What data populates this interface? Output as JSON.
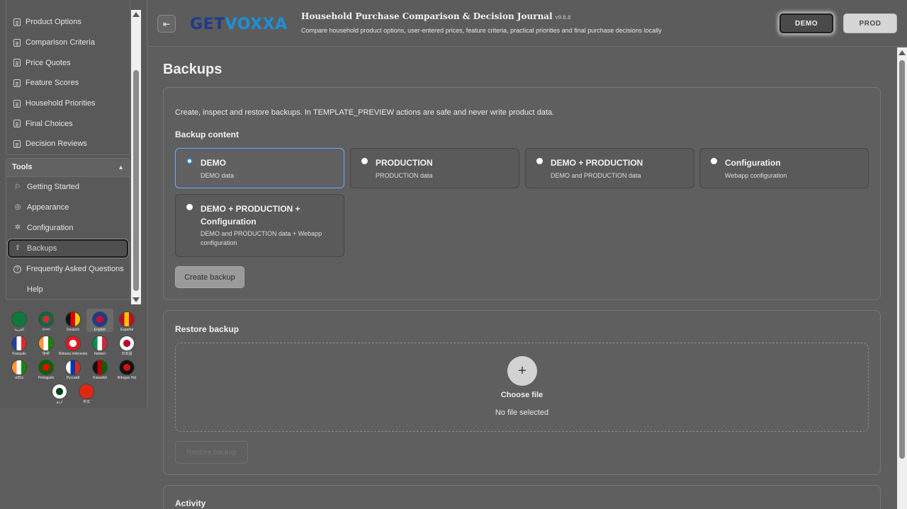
{
  "sidebar": {
    "items": [
      {
        "label": "Product Options"
      },
      {
        "label": "Comparison Criteria"
      },
      {
        "label": "Price Quotes"
      },
      {
        "label": "Feature Scores"
      },
      {
        "label": "Household Priorities"
      },
      {
        "label": "Final Choices"
      },
      {
        "label": "Decision Reviews"
      }
    ],
    "tools_title": "Tools",
    "tools": [
      {
        "label": "Getting Started",
        "icon": "flag-icon"
      },
      {
        "label": "Appearance",
        "icon": "palette-icon"
      },
      {
        "label": "Configuration",
        "icon": "gear-icon"
      },
      {
        "label": "Backups",
        "icon": "upload-icon",
        "active": true
      },
      {
        "label": "Frequently Asked Questions",
        "icon": "question-icon"
      },
      {
        "label": "Help",
        "icon": "none"
      }
    ]
  },
  "languages": [
    {
      "label": "العربية",
      "colors": [
        "#0b7a3b",
        "#0b7a3b"
      ]
    },
    {
      "label": "বাংলা",
      "colors": [
        "#0a6a3f",
        "#d42a3c"
      ]
    },
    {
      "label": "Deutsch",
      "colors": [
        "#111111",
        "#dd0000",
        "#ffcc00"
      ]
    },
    {
      "label": "English",
      "colors": [
        "#1f3b8c",
        "#c8102e"
      ],
      "selected": true
    },
    {
      "label": "Español",
      "colors": [
        "#c60b1e",
        "#ffc400",
        "#c60b1e"
      ]
    },
    {
      "label": "Français",
      "colors": [
        "#1f3f99",
        "#ffffff",
        "#e1262d"
      ]
    },
    {
      "label": "हिन्दी",
      "colors": [
        "#ff9933",
        "#ffffff",
        "#138808"
      ]
    },
    {
      "label": "Bahasa Indonesia",
      "colors": [
        "#e11a22",
        "#ffffff"
      ]
    },
    {
      "label": "Italiano",
      "colors": [
        "#009246",
        "#ffffff",
        "#ce2b37"
      ]
    },
    {
      "label": "日本語",
      "colors": [
        "#ffffff",
        "#bc002d"
      ]
    },
    {
      "label": "ଓଡ଼ିଆ",
      "colors": [
        "#ff9933",
        "#ffffff",
        "#138808"
      ]
    },
    {
      "label": "Português",
      "colors": [
        "#006600",
        "#ff0000"
      ]
    },
    {
      "label": "Русский",
      "colors": [
        "#ffffff",
        "#0039a6",
        "#d52b1e"
      ]
    },
    {
      "label": "Kiswahili",
      "colors": [
        "#111111",
        "#bb0000",
        "#006600"
      ]
    },
    {
      "label": "tlhIngan Hol",
      "colors": [
        "#111111",
        "#cc1111"
      ]
    },
    {
      "label": "اردو",
      "colors": [
        "#ffffff",
        "#01411c"
      ]
    },
    {
      "label": "中文",
      "colors": [
        "#de2910",
        "#de2910"
      ]
    }
  ],
  "header": {
    "logo_a": "GET",
    "logo_b": "V",
    "logo_c": "OXXA",
    "title": "Household Purchase Comparison & Decision Journal",
    "version": "v9.8.8",
    "subtitle": "Compare household product options, user-entered prices, feature criteria, practical priorities and final purchase decisions locally",
    "env_demo": "DEMO",
    "env_prod": "PROD"
  },
  "page": {
    "title": "Backups",
    "intro": "Create, inspect and restore backups. In TEMPLATE_PREVIEW actions are safe and never write product data.",
    "backup_content_label": "Backup content",
    "options": [
      {
        "title": "DEMO",
        "desc": "DEMO data",
        "selected": true
      },
      {
        "title": "PRODUCTION",
        "desc": "PRODUCTION data"
      },
      {
        "title": "DEMO + PRODUCTION",
        "desc": "DEMO and PRODUCTION data"
      },
      {
        "title": "Configuration",
        "desc": "Webapp configuration"
      },
      {
        "title": "DEMO + PRODUCTION + Configuration",
        "desc": "DEMO and PRODUCTION data + Webapp configuration"
      }
    ],
    "create_backup": "Create backup",
    "restore_title": "Restore backup",
    "choose_file": "Choose file",
    "no_file": "No file selected",
    "restore_button": "Restore backup",
    "activity_title": "Activity"
  },
  "colors": {
    "accent": "#2f7be0",
    "background": "#5e5e5e"
  }
}
